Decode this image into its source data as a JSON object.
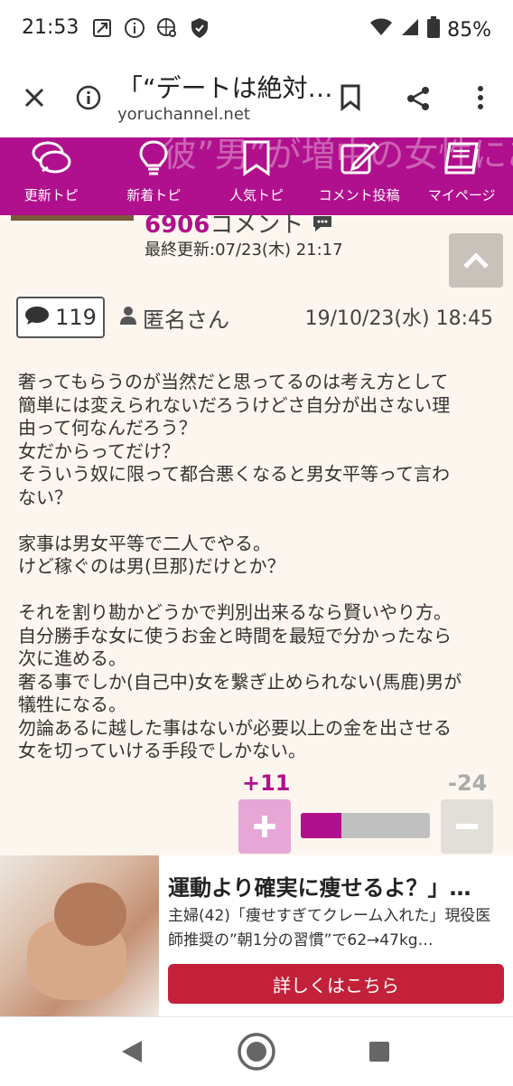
{
  "status_bar": {
    "time": "21:53",
    "battery": "85%",
    "icons": [
      "notification-icon",
      "info-icon",
      "globe-search-icon",
      "shield-icon"
    ]
  },
  "browser": {
    "page_title": "「“デートは絶対…",
    "url": "yoruchannel.net"
  },
  "nav": {
    "background_text": "彼”男”が増中の女性にありしいうつの理由",
    "items": [
      {
        "label": "更新トピ",
        "icon": "chat-bubbles-icon"
      },
      {
        "label": "新着トピ",
        "icon": "lightbulb-icon"
      },
      {
        "label": "人気トピ",
        "icon": "bookmark-icon"
      },
      {
        "label": "コメント投稿",
        "icon": "edit-icon"
      },
      {
        "label": "マイページ",
        "icon": "book-icon"
      }
    ]
  },
  "topic": {
    "comment_count": "6906",
    "comment_suffix": "コメント",
    "updated": "最終更新:07/23(木) 21:17"
  },
  "comment": {
    "number": "119",
    "author": "匿名さん",
    "date": "19/10/23(水) 18:45",
    "body": [
      "奢ってもらうのが当然だと思ってるのは考え方として",
      "簡単には変えられないだろうけどさ自分が出さない理",
      "由って何なんだろう？",
      "女だからってだけ？",
      "そういう奴に限って都合悪くなると男女平等って言わ",
      "ない？",
      "",
      "家事は男女平等で二人でやる。",
      "けど稼ぐのは男(旦那)だけとか？",
      "",
      "それを割り勘かどうかで判別出来るなら賢いやり方。",
      "自分勝手な女に使うお金と時間を最短で分かったなら",
      "次に進める。",
      "奢る事でしか(自己中)女を繋ぎ止められない(馬鹿)男が",
      "犠牲になる。",
      "勿論あるに越した事はないが必要以上の金を出させる",
      "女を切っていける手段でしかない。"
    ],
    "plus": "+11",
    "minus": "-24",
    "plus_fraction": 0.314
  },
  "ad": {
    "headline": "運動より確実に痩せるよ？」…",
    "description": "主婦(42)「痩せすぎてクレーム入れた」現役医師推奨の”朝1分の習慣”で62→47kg…",
    "cta": "詳しくはこちら"
  },
  "colors": {
    "brand": "#b0108d",
    "cta": "#c3213a",
    "background": "#fcf6ee"
  }
}
